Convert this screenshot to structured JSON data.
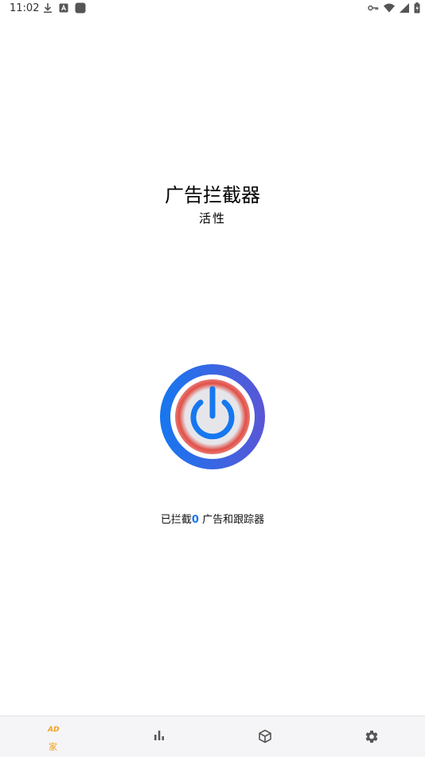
{
  "status_bar": {
    "time": "11:02",
    "left_icons": [
      "download-icon",
      "a-box-icon",
      "app-square-icon"
    ],
    "right_icons": [
      "vpn-key-icon",
      "wifi-icon",
      "signal-icon",
      "battery-icon"
    ]
  },
  "header": {
    "title": "广告拦截器",
    "status": "活性"
  },
  "power_button": {
    "icon": "power-icon",
    "colors": {
      "ring_start": "#1677f0",
      "ring_end": "#5a56d6",
      "glow": "#e05048"
    }
  },
  "summary": {
    "prefix": "已拦截",
    "count": "0",
    "suffix": " 广告和跟踪器"
  },
  "bottom_nav": {
    "home": {
      "logo_text": "AD",
      "label": "家",
      "active_color": "#f2a11d"
    },
    "stats": {
      "icon": "bar-chart-icon"
    },
    "apps": {
      "icon": "cube-icon"
    },
    "settings": {
      "icon": "gear-icon"
    }
  }
}
